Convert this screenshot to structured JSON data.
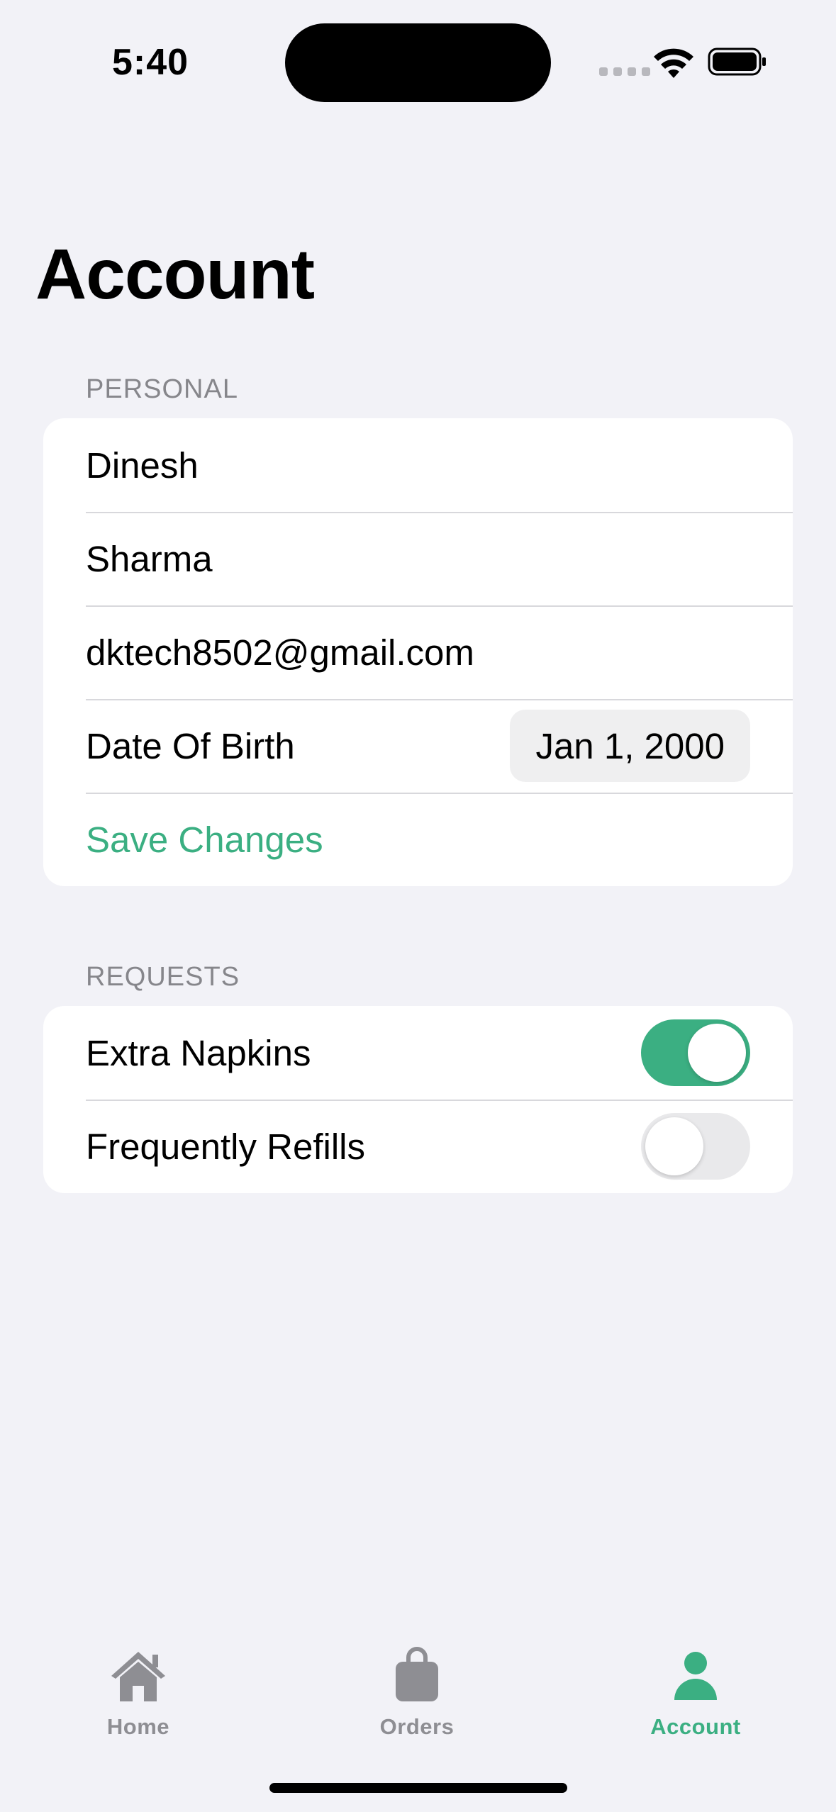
{
  "status_bar": {
    "time": "5:40"
  },
  "title": "Account",
  "sections": {
    "personal": {
      "header": "PERSONAL",
      "first_name": "Dinesh",
      "last_name": "Sharma",
      "email": "dktech8502@gmail.com",
      "dob_label": "Date Of Birth",
      "dob_value": "Jan 1, 2000",
      "save_label": "Save Changes"
    },
    "requests": {
      "header": "REQUESTS",
      "items": [
        {
          "label": "Extra Napkins",
          "on": true
        },
        {
          "label": "Frequently Refills",
          "on": false
        }
      ]
    }
  },
  "tab_bar": {
    "tabs": [
      {
        "label": "Home",
        "icon": "house-icon",
        "active": false
      },
      {
        "label": "Orders",
        "icon": "bag-icon",
        "active": false
      },
      {
        "label": "Account",
        "icon": "person-icon",
        "active": true
      }
    ]
  },
  "colors": {
    "accent": "#3BAF82",
    "background": "#F2F2F7",
    "inactive": "#8E8E93"
  }
}
